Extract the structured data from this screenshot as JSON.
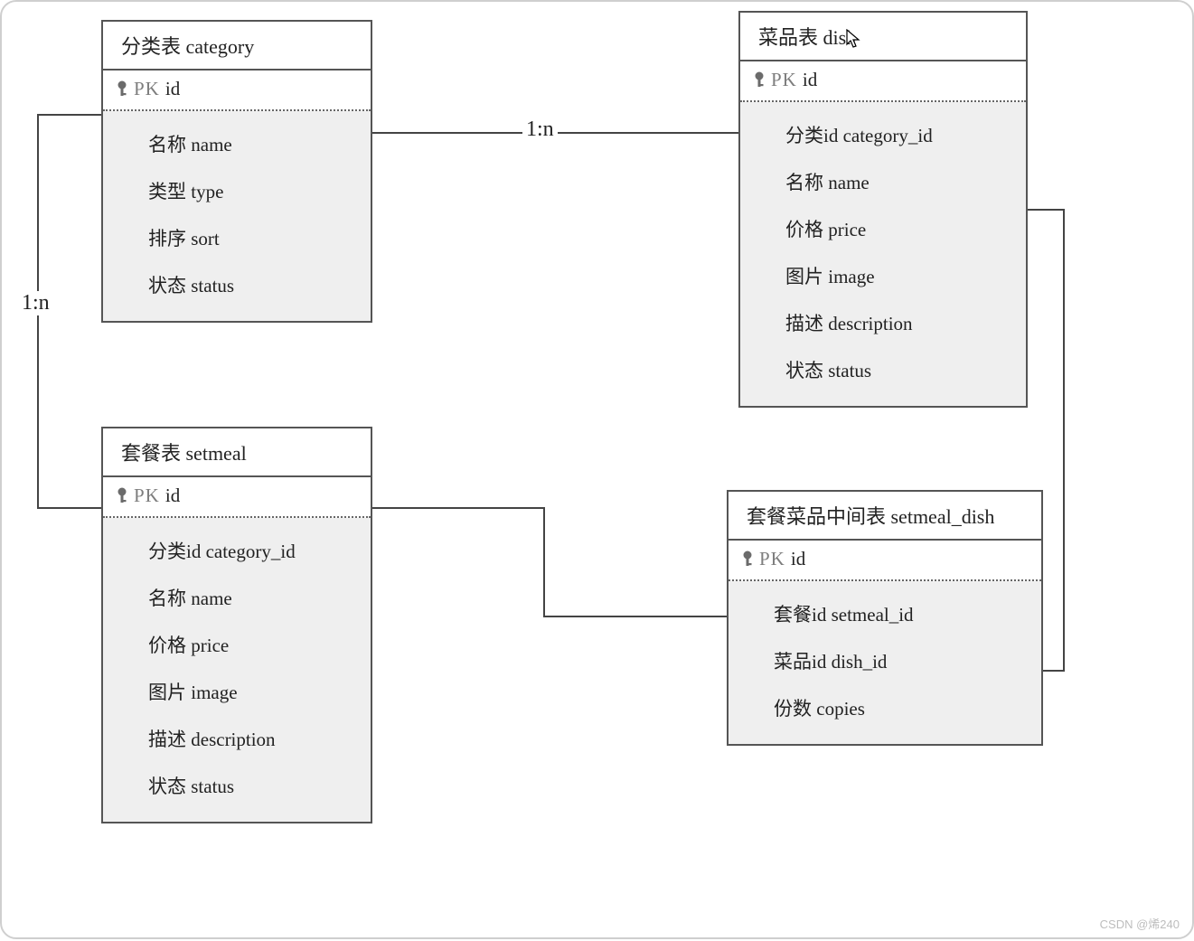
{
  "relations": {
    "cat_dish": "1:n",
    "cat_setmeal": "1:n"
  },
  "entities": {
    "category": {
      "title": "分类表 category",
      "pk_label": "PK",
      "pk_field": "id",
      "fields": [
        "名称 name",
        "类型 type",
        "排序 sort",
        "状态 status"
      ]
    },
    "dish": {
      "title": "菜品表 dish",
      "pk_label": "PK",
      "pk_field": "id",
      "fields": [
        "分类id category_id",
        "名称 name",
        "价格 price",
        "图片 image",
        "描述 description",
        "状态 status"
      ]
    },
    "setmeal": {
      "title": "套餐表 setmeal",
      "pk_label": "PK",
      "pk_field": "id",
      "fields": [
        "分类id category_id",
        "名称 name",
        "价格 price",
        "图片 image",
        "描述 description",
        "状态 status"
      ]
    },
    "setmeal_dish": {
      "title": "套餐菜品中间表 setmeal_dish",
      "pk_label": "PK",
      "pk_field": "id",
      "fields": [
        "套餐id setmeal_id",
        "菜品id dish_id",
        "份数 copies"
      ]
    }
  },
  "watermark": "CSDN @烯240"
}
